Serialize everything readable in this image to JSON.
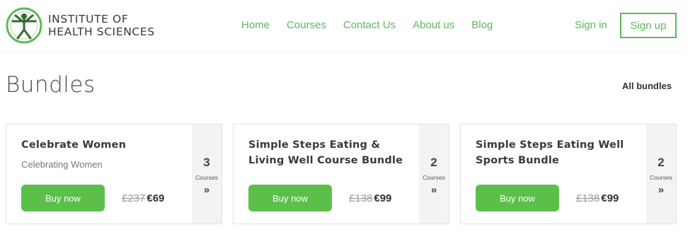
{
  "header": {
    "logo_line1": "INSTITUTE OF",
    "logo_line2": "HEALTH SCIENCES",
    "nav": [
      "Home",
      "Courses",
      "Contact Us",
      "About us",
      "Blog"
    ],
    "signin": "Sign in",
    "signup": "Sign up"
  },
  "colors": {
    "accent": "#5cb85c",
    "button": "#5cbf4a"
  },
  "section": {
    "title": "Bundles",
    "all_link": "All bundles"
  },
  "cards": [
    {
      "title": "Celebrate Women",
      "subtitle": "Celebrating Women",
      "buy": "Buy now",
      "old_price": "£237",
      "new_price": "€69",
      "count": "3",
      "count_label": "Courses",
      "arrow": "»"
    },
    {
      "title": "Simple Steps Eating & Living Well Course Bundle",
      "subtitle": "",
      "buy": "Buy now",
      "old_price": "£138",
      "new_price": "€99",
      "count": "2",
      "count_label": "Courses",
      "arrow": "»"
    },
    {
      "title": "Simple Steps Eating Well Sports Bundle",
      "subtitle": "",
      "buy": "Buy now",
      "old_price": "£138",
      "new_price": "€99",
      "count": "2",
      "count_label": "Courses",
      "arrow": "»"
    }
  ]
}
